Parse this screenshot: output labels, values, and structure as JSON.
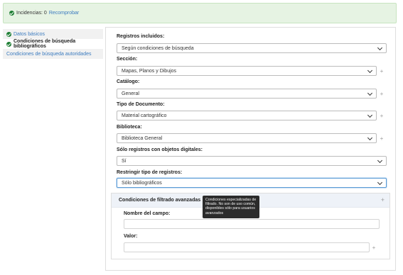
{
  "alert": {
    "text": "Incidencias: 0",
    "link": "Recomprobar"
  },
  "sidebar": {
    "items": [
      {
        "label": "Datos básicos"
      },
      {
        "label": "Condiciones de búsqueda bibliográficos"
      },
      {
        "label": "Condiciones de búsqueda autoridades"
      }
    ]
  },
  "form": {
    "registros": {
      "label": "Registros incluidos:",
      "value": "Según condiciones de búsqueda"
    },
    "seccion": {
      "label": "Sección:",
      "value": "Mapas, Planos y Dibujos"
    },
    "catalogo": {
      "label": "Catálogo:",
      "value": "General"
    },
    "tipo_documento": {
      "label": "Tipo de Documento:",
      "value": "Material cartográfico"
    },
    "biblioteca": {
      "label": "Biblioteca:",
      "value": "Biblioteca General"
    },
    "digitales": {
      "label": "Sólo registros con objetos digitales:",
      "value": "Sí"
    },
    "restringir": {
      "label": "Restringir tipo de registros:",
      "value": "Sólo bibliográficos"
    },
    "plus_symbol": "+"
  },
  "advanced": {
    "title": "Condiciones de filtrado avanzadas",
    "help_symbol": "?",
    "tooltip": "Condiciones especializadas de filtrado. No son de uso común, disponibles sólo para usuarios avanzados",
    "nombre_label": "Nombre del campo:",
    "valor_label": "Valor:",
    "plus_symbol": "+"
  },
  "colors": {
    "alert_bg": "#e6f3e3",
    "link": "#3b7bbf",
    "check": "#1e7e34",
    "tooltip_bg": "#2b2b2b"
  },
  "icons": [
    "check-circle-icon",
    "chevron-down-icon",
    "plus-icon",
    "help-circle-icon"
  ]
}
